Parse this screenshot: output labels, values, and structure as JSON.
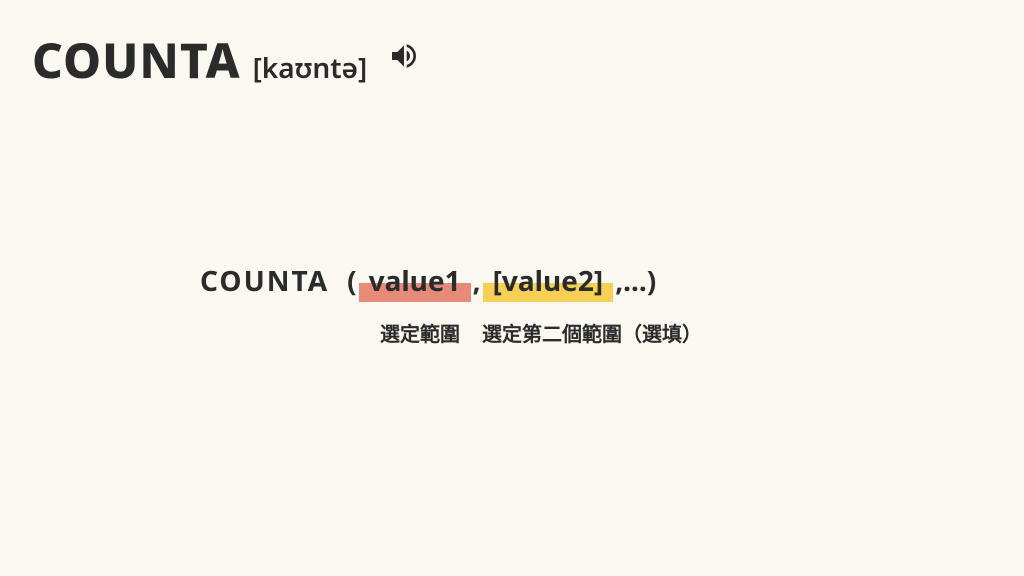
{
  "header": {
    "title": "COUNTA",
    "phonetic": "[kaʊntə]"
  },
  "formula": {
    "function_name": "COUNTA",
    "open_paren": "(",
    "value1": "value1",
    "comma1": ",",
    "value2": "[value2]",
    "rest": ",...)"
  },
  "annotations": {
    "anno1": "選定範圍",
    "anno2": "選定第二個範圍（選填）"
  }
}
